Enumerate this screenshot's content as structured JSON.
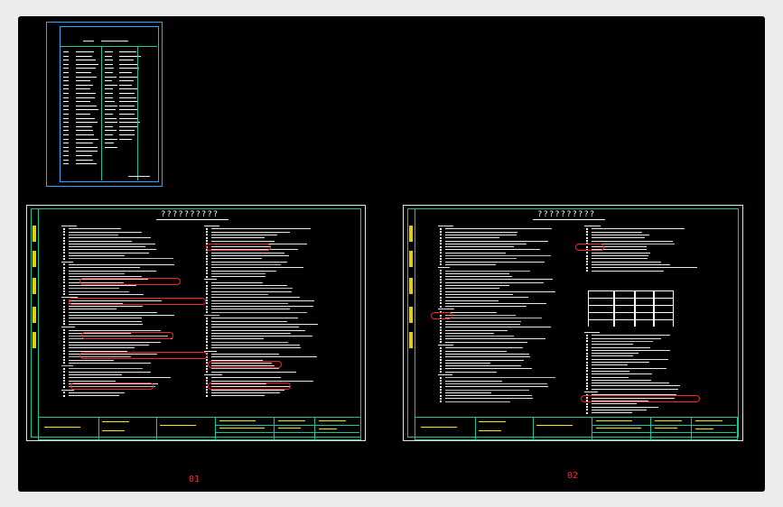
{
  "sheets": [
    {
      "label": "01"
    },
    {
      "label": "02"
    }
  ],
  "colors": {
    "background": "#000000",
    "frame": "#e6e6e6",
    "border": "#19c896",
    "cover_border": "#2aa8ff",
    "markup": "#ff2020",
    "label": "#ff2b2b",
    "accent_text": "#ffe600"
  }
}
